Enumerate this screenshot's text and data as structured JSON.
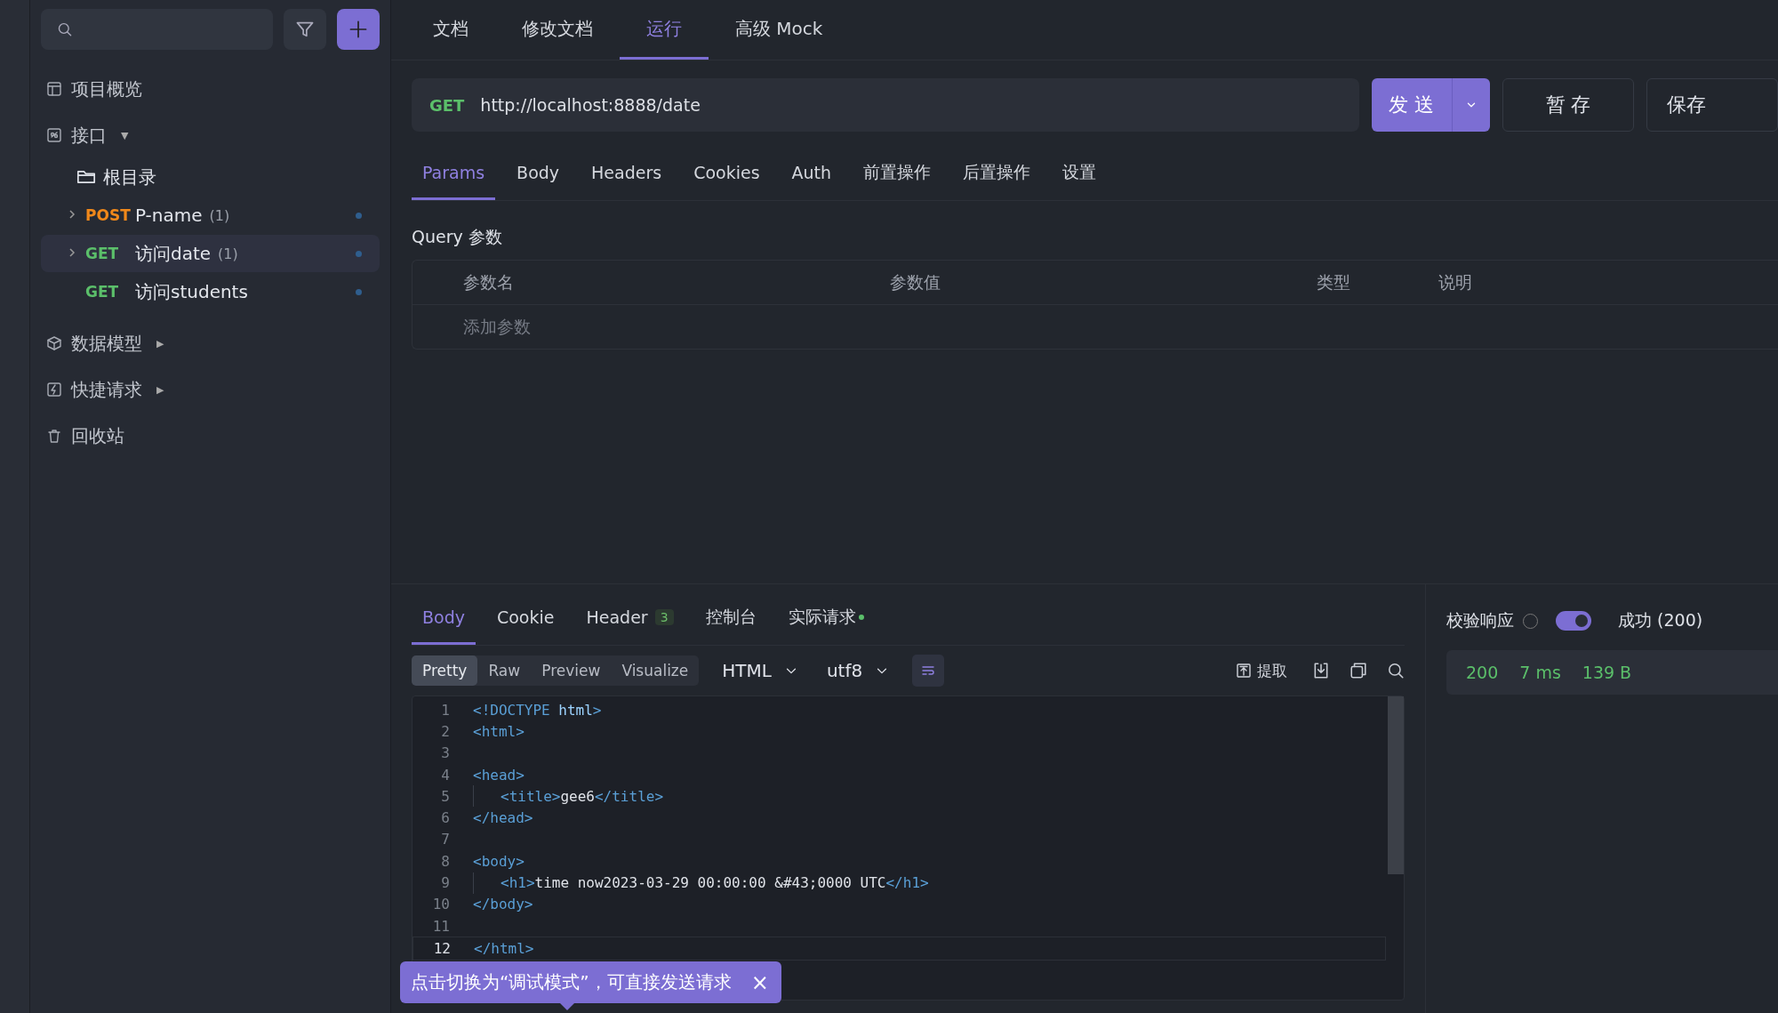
{
  "sidebar": {
    "nav": [
      {
        "kind": "overview",
        "label": "项目概览"
      },
      {
        "kind": "api",
        "label": "接口",
        "caret": "▼"
      }
    ],
    "tree": {
      "folder": "根目录",
      "items": [
        {
          "method": "POST",
          "name": "P-name",
          "count": "(1)",
          "expandable": true,
          "selected": false
        },
        {
          "method": "GET",
          "name": "访问date",
          "count": "(1)",
          "expandable": true,
          "selected": true
        },
        {
          "method": "GET",
          "name": "访问students",
          "expandable": false,
          "selected": false
        }
      ]
    },
    "nav_bottom": [
      {
        "kind": "model",
        "label": "数据模型",
        "caret": "▶"
      },
      {
        "kind": "quick",
        "label": "快捷请求",
        "caret": "▶"
      },
      {
        "kind": "trash",
        "label": "回收站"
      }
    ]
  },
  "top_tabs": [
    {
      "label": "文档",
      "selected": false
    },
    {
      "label": "修改文档",
      "selected": false
    },
    {
      "label": "运行",
      "selected": true
    },
    {
      "label": "高级 Mock",
      "selected": false
    }
  ],
  "request": {
    "method": "GET",
    "url": "http://localhost:8888/date",
    "send": "发 送",
    "stash": "暂 存",
    "save": "保存"
  },
  "request_tabs": [
    {
      "label": "Params",
      "selected": true
    },
    {
      "label": "Body",
      "selected": false
    },
    {
      "label": "Headers",
      "selected": false
    },
    {
      "label": "Cookies",
      "selected": false
    },
    {
      "label": "Auth",
      "selected": false
    },
    {
      "label": "前置操作",
      "selected": false
    },
    {
      "label": "后置操作",
      "selected": false
    },
    {
      "label": "设置",
      "selected": false
    }
  ],
  "query": {
    "title": "Query 参数",
    "columns": [
      "参数名",
      "参数值",
      "类型",
      "说明"
    ],
    "add_placeholder": "添加参数"
  },
  "response_tabs": [
    {
      "label": "Body",
      "selected": true
    },
    {
      "label": "Cookie",
      "selected": false
    },
    {
      "label": "Header",
      "badge": "3",
      "selected": false
    },
    {
      "label": "控制台",
      "selected": false
    },
    {
      "label": "实际请求",
      "dot": true,
      "selected": false
    }
  ],
  "format_tabs": [
    {
      "label": "Pretty",
      "selected": true
    },
    {
      "label": "Raw",
      "selected": false
    },
    {
      "label": "Preview",
      "selected": false
    },
    {
      "label": "Visualize",
      "selected": false
    }
  ],
  "format": {
    "language": "HTML",
    "encoding": "utf8",
    "extract": "提取"
  },
  "code": [
    {
      "num": "1",
      "tokens": [
        {
          "kind": "tag",
          "text": "<!DOCTYPE "
        },
        {
          "kind": "attr",
          "text": "html"
        },
        {
          "kind": "tag",
          "text": ">"
        }
      ]
    },
    {
      "num": "2",
      "tokens": [
        {
          "kind": "tag",
          "text": "<html>"
        }
      ]
    },
    {
      "num": "3"
    },
    {
      "num": "4",
      "tokens": [
        {
          "kind": "tag",
          "text": "<head>"
        }
      ]
    },
    {
      "num": "5",
      "guide": true,
      "tokens": [
        {
          "kind": "tag",
          "text": "<title>"
        },
        {
          "kind": "text",
          "text": "gee6"
        },
        {
          "kind": "tag",
          "text": "</title>"
        }
      ]
    },
    {
      "num": "6",
      "tokens": [
        {
          "kind": "tag",
          "text": "</head>"
        }
      ]
    },
    {
      "num": "7"
    },
    {
      "num": "8",
      "tokens": [
        {
          "kind": "tag",
          "text": "<body>"
        }
      ]
    },
    {
      "num": "9",
      "guide": true,
      "tokens": [
        {
          "kind": "tag",
          "text": "<h1>"
        },
        {
          "kind": "text",
          "text": "time now2023-03-29 00:00:00 &#43;0000 UTC"
        },
        {
          "kind": "tag",
          "text": "</h1>"
        }
      ]
    },
    {
      "num": "10",
      "tokens": [
        {
          "kind": "tag",
          "text": "</body>"
        }
      ]
    },
    {
      "num": "11"
    },
    {
      "num": "12",
      "current": true,
      "tokens": [
        {
          "kind": "tag",
          "text": "</html>"
        }
      ]
    }
  ],
  "validate": {
    "label": "校验响应",
    "on": true,
    "result": "成功 (200)"
  },
  "stats": [
    "200",
    "7 ms",
    "139 B"
  ],
  "toast": {
    "text": "点击切换为“调试模式”，可直接发送请求",
    "close": "×"
  }
}
